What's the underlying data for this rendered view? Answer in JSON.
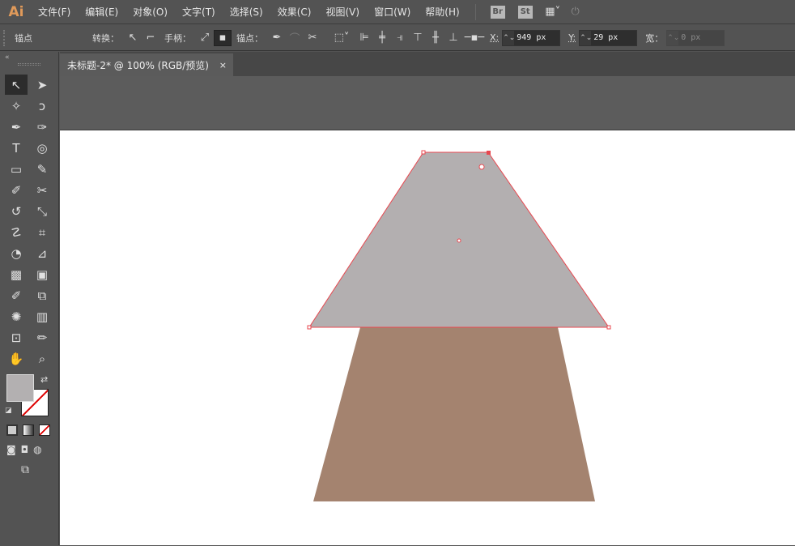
{
  "menubar": {
    "logo": "Ai",
    "items": [
      "文件(F)",
      "编辑(E)",
      "对象(O)",
      "文字(T)",
      "选择(S)",
      "效果(C)",
      "视图(V)",
      "窗口(W)",
      "帮助(H)"
    ],
    "bridge": "Br",
    "stock": "St"
  },
  "control": {
    "mode": "锚点",
    "convert": "转换：",
    "handles": "手柄：",
    "anchors": "锚点：",
    "x_label": "X:",
    "x_value": "949 px",
    "y_label": "Y:",
    "y_value": "29 px",
    "w_label": "宽：",
    "w_value": "0 px"
  },
  "tab": {
    "title": "未标题-2* @ 100% (RGB/预览)",
    "close": "×"
  },
  "tools": [
    "selection-tool",
    "direct-selection-tool",
    "magic-wand-tool",
    "lasso-tool",
    "pen-tool",
    "curvature-tool",
    "type-tool",
    "spiral-tool",
    "rectangle-tool",
    "paintbrush-tool",
    "shaper-tool",
    "scissors-tool",
    "rotate-tool",
    "scale-tool",
    "warp-tool",
    "free-transform-tool",
    "shape-builder-tool",
    "perspective-grid-tool",
    "mesh-tool",
    "gradient-tool",
    "eyedropper-tool",
    "blend-tool",
    "symbol-sprayer-tool",
    "column-graph-tool",
    "artboard-tool",
    "slice-tool",
    "hand-tool",
    "zoom-tool"
  ],
  "colors": {
    "fill": "#b3b0b1",
    "top_shape": "#b3afb0",
    "bottom_shape": "#a4836f",
    "selection": "#e8474f"
  }
}
